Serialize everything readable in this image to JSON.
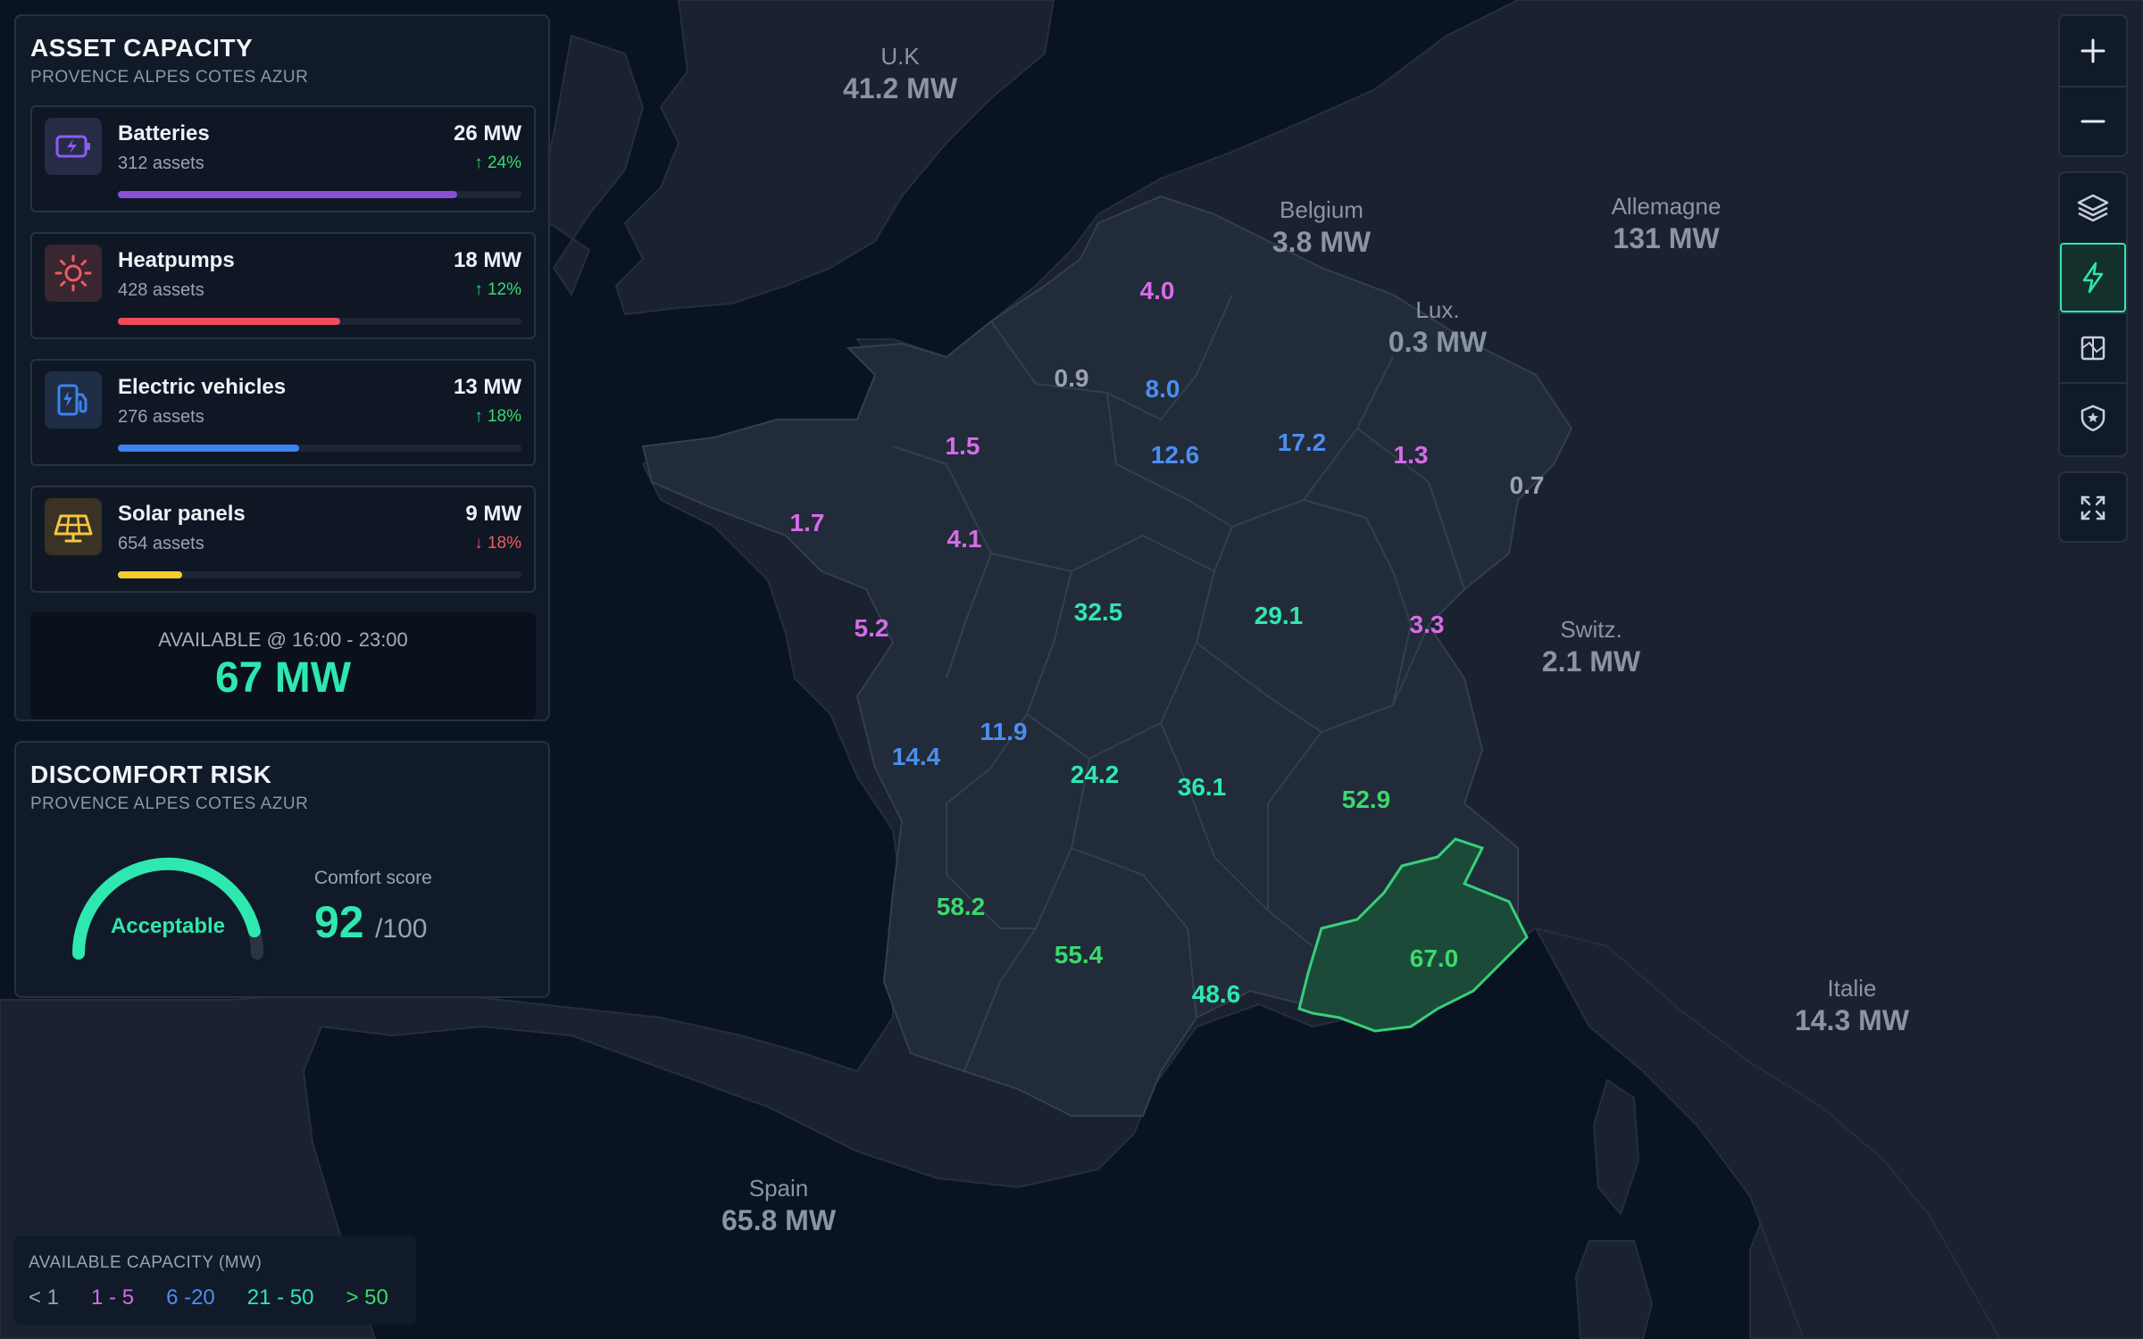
{
  "asset_capacity": {
    "title": "ASSET CAPACITY",
    "region": "PROVENCE ALPES COTES AZUR",
    "assets": [
      {
        "name": "Batteries",
        "count": "312 assets",
        "mw": "26 MW",
        "delta": "↑ 24%",
        "trend": "up",
        "share": 0.84,
        "bar_color": "#8a4fd8",
        "icon": "battery-icon",
        "icon_color": "#8a5cf6",
        "icon_bg": "#262c45"
      },
      {
        "name": "Heatpumps",
        "count": "428 assets",
        "mw": "18 MW",
        "delta": "↑ 12%",
        "trend": "up",
        "share": 0.55,
        "bar_color": "#ef4b5c",
        "icon": "sun-icon",
        "icon_color": "#f05b5b",
        "icon_bg": "#3a2630"
      },
      {
        "name": "Electric vehicles",
        "count": "276 assets",
        "mw": "13 MW",
        "delta": "↑ 18%",
        "trend": "up",
        "share": 0.45,
        "bar_color": "#3c82f0",
        "icon": "ev-charger-icon",
        "icon_color": "#3c82f0",
        "icon_bg": "#1f2d45"
      },
      {
        "name": "Solar panels",
        "count": "654 assets",
        "mw": "9 MW",
        "delta": "↓ 18%",
        "trend": "down",
        "share": 0.16,
        "bar_color": "#f5cc2e",
        "icon": "solar-panel-icon",
        "icon_color": "#f5c542",
        "icon_bg": "#3a3224"
      }
    ],
    "available_label": "AVAILABLE @ 16:00 - 23:00",
    "available_value": "67 MW"
  },
  "discomfort_risk": {
    "title": "DISCOMFORT RISK",
    "region": "PROVENCE ALPES COTES AZUR",
    "gauge_label": "Acceptable",
    "gauge_fraction": 0.92,
    "score_label": "Comfort score",
    "score": "92",
    "score_max": "/100"
  },
  "countries": [
    {
      "name": "U.K",
      "value": "41.2 MW"
    },
    {
      "name": "Belgium",
      "value": "3.8 MW"
    },
    {
      "name": "Allemagne",
      "value": "131 MW"
    },
    {
      "name": "Lux.",
      "value": "0.3 MW"
    },
    {
      "name": "Switz.",
      "value": "2.1 MW"
    },
    {
      "name": "Italie",
      "value": "14.3 MW"
    },
    {
      "name": "Spain",
      "value": "65.8 MW"
    }
  ],
  "regions": [
    {
      "value": "4.0",
      "color": "#d56ce8"
    },
    {
      "value": "0.9",
      "color": "#9aa3ae"
    },
    {
      "value": "8.0",
      "color": "#4a8ff0"
    },
    {
      "value": "1.5",
      "color": "#d56ce8"
    },
    {
      "value": "12.6",
      "color": "#4a8ff0"
    },
    {
      "value": "17.2",
      "color": "#4a8ff0"
    },
    {
      "value": "1.3",
      "color": "#d56ce8"
    },
    {
      "value": "0.7",
      "color": "#9aa3ae"
    },
    {
      "value": "1.7",
      "color": "#d56ce8"
    },
    {
      "value": "4.1",
      "color": "#d56ce8"
    },
    {
      "value": "32.5",
      "color": "#2ee8b0"
    },
    {
      "value": "29.1",
      "color": "#2ee8b0"
    },
    {
      "value": "3.3",
      "color": "#d56ce8"
    },
    {
      "value": "5.2",
      "color": "#d56ce8"
    },
    {
      "value": "11.9",
      "color": "#4a8ff0"
    },
    {
      "value": "14.4",
      "color": "#4a8ff0"
    },
    {
      "value": "24.2",
      "color": "#2ee8b0"
    },
    {
      "value": "36.1",
      "color": "#2ee8b0"
    },
    {
      "value": "52.9",
      "color": "#3bd96c"
    },
    {
      "value": "58.2",
      "color": "#3bd96c"
    },
    {
      "value": "55.4",
      "color": "#3bd96c"
    },
    {
      "value": "48.6",
      "color": "#2ee8b0"
    },
    {
      "value": "67.0",
      "color": "#3bd96c"
    }
  ],
  "legend": {
    "title": "AVAILABLE CAPACITY (MW)",
    "items": [
      {
        "label": "< 1",
        "color": "#9aa3ae"
      },
      {
        "label": "1 - 5",
        "color": "#d56ce8"
      },
      {
        "label": "6 -20",
        "color": "#4a8ff0"
      },
      {
        "label": "21 - 50",
        "color": "#2ee8b0"
      },
      {
        "label": "> 50",
        "color": "#3bd96c"
      }
    ]
  },
  "controls": [
    "zoom-in-icon",
    "zoom-out-icon",
    "layers-icon",
    "lightning-icon",
    "map-style-icon",
    "shield-star-icon",
    "fullscreen-icon"
  ],
  "colors": {
    "accent": "#2ee8b0",
    "selected_region": "#36d07a"
  }
}
